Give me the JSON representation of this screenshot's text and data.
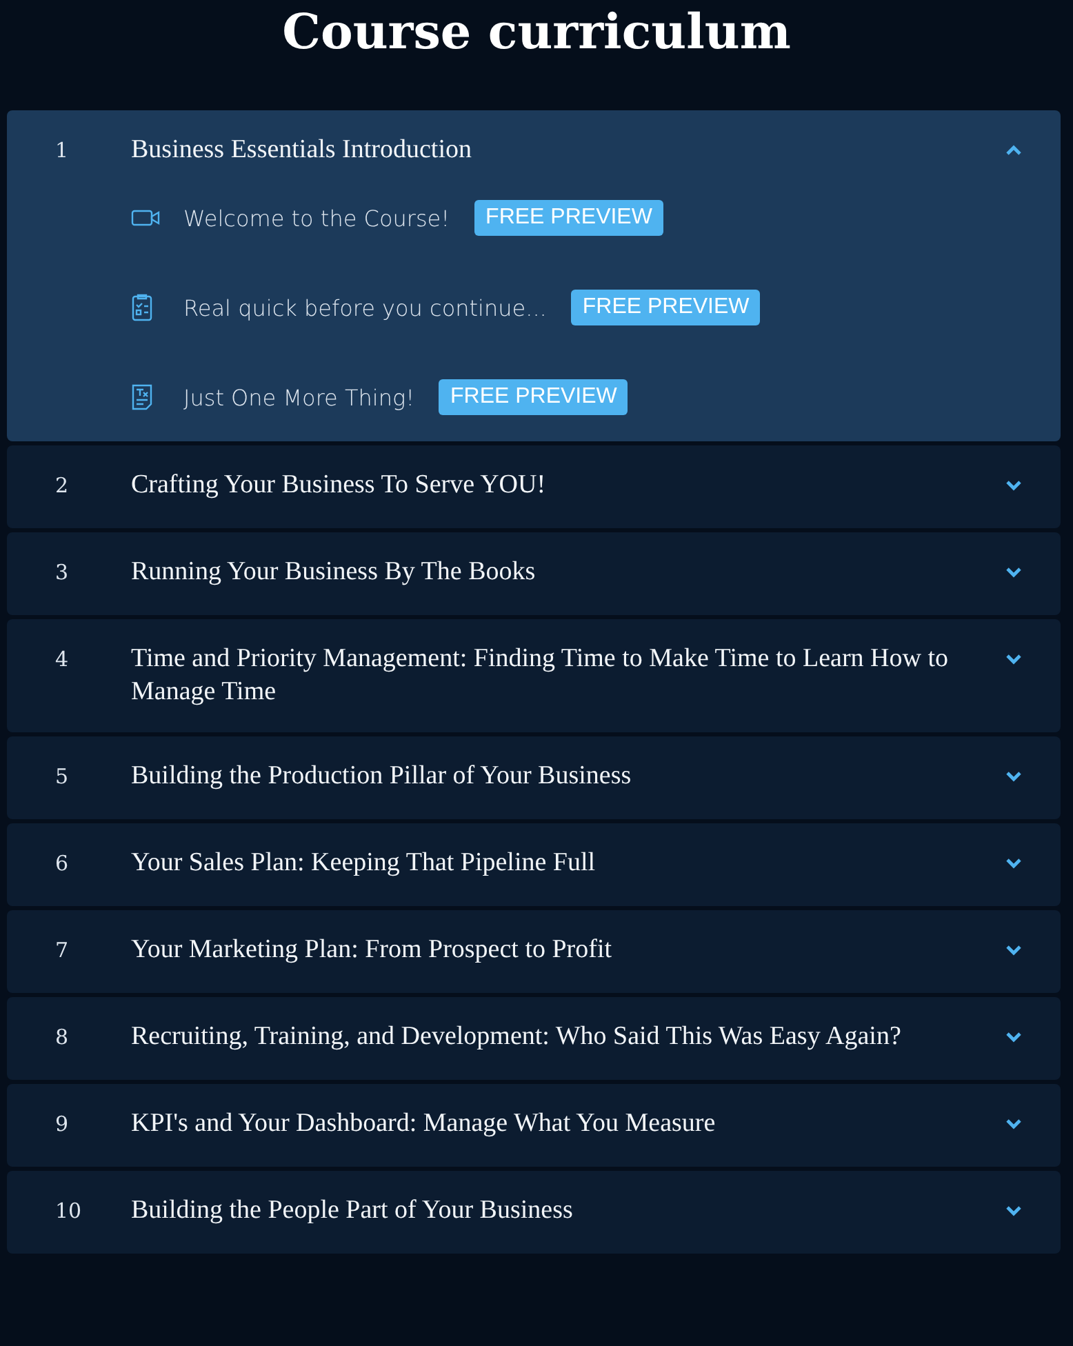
{
  "title": "Course curriculum",
  "sections": [
    {
      "number": "1",
      "title": "Business Essentials Introduction",
      "expanded": true,
      "lessons": [
        {
          "kind": "video",
          "title": "Welcome to the Course!",
          "badge": "FREE PREVIEW"
        },
        {
          "kind": "quiz",
          "title": "Real quick before you continue...",
          "badge": "FREE PREVIEW"
        },
        {
          "kind": "text",
          "title": "Just One More Thing!",
          "badge": "FREE PREVIEW"
        }
      ]
    },
    {
      "number": "2",
      "title": "Crafting Your Business To Serve YOU!",
      "expanded": false
    },
    {
      "number": "3",
      "title": "Running Your Business By The Books",
      "expanded": false
    },
    {
      "number": "4",
      "title": "Time and Priority Management: Finding Time to Make Time to Learn How to Manage Time",
      "expanded": false
    },
    {
      "number": "5",
      "title": "Building the Production Pillar of Your Business",
      "expanded": false
    },
    {
      "number": "6",
      "title": "Your Sales Plan: Keeping That Pipeline Full",
      "expanded": false
    },
    {
      "number": "7",
      "title": "Your Marketing Plan: From Prospect to Profit",
      "expanded": false
    },
    {
      "number": "8",
      "title": "Recruiting, Training, and Development: Who Said This Was Easy Again?",
      "expanded": false
    },
    {
      "number": "9",
      "title": "KPI's and Your Dashboard: Manage What You Measure",
      "expanded": false
    },
    {
      "number": "10",
      "title": "Building the People Part of Your Business",
      "expanded": false
    }
  ]
}
